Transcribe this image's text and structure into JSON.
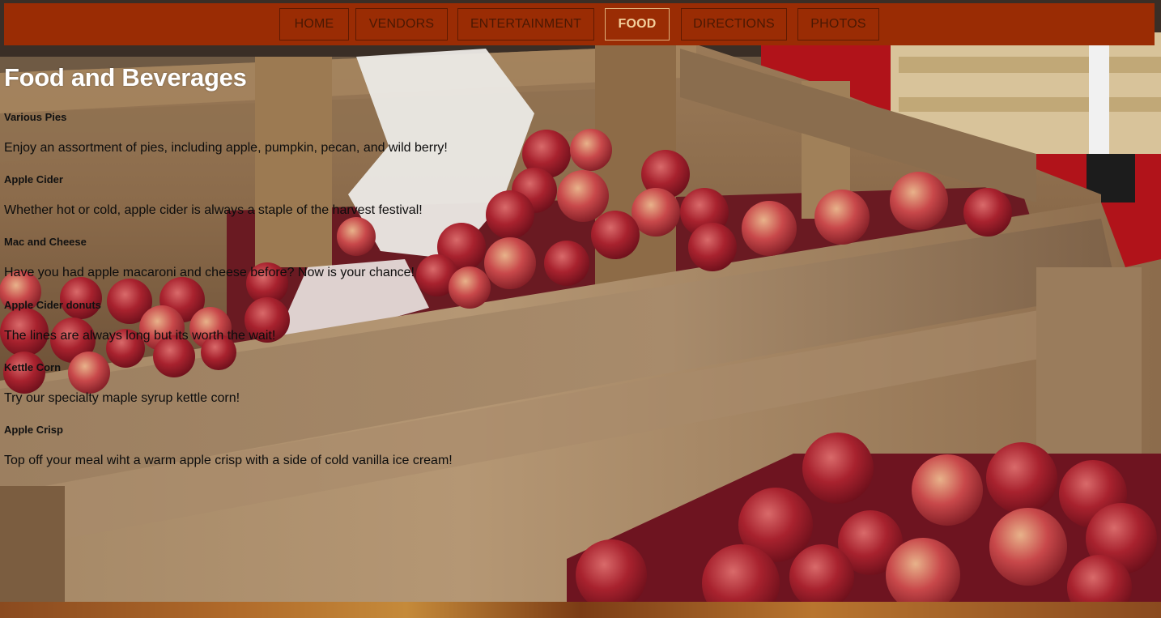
{
  "nav": {
    "items": [
      {
        "label": "HOME",
        "active": false
      },
      {
        "label": "VENDORS",
        "active": false
      },
      {
        "label": "ENTERTAINMENT",
        "active": false
      },
      {
        "label": "FOOD",
        "active": true
      },
      {
        "label": "DIRECTIONS",
        "active": false
      },
      {
        "label": "PHOTOS",
        "active": false
      }
    ]
  },
  "page": {
    "title": "Food and Beverages"
  },
  "menu": [
    {
      "name": "Various Pies",
      "description": "Enjoy an assortment of pies, including apple, pumpkin, pecan, and wild berry!"
    },
    {
      "name": "Apple Cider",
      "description": "Whether hot or cold, apple cider is always a staple of the harvest festival!"
    },
    {
      "name": "Mac and Cheese",
      "description": "Have you had apple macaroni and cheese before? Now is your chance!"
    },
    {
      "name": "Apple Cider donuts",
      "description": "The lines are always long but its worth the wait!"
    },
    {
      "name": "Kettle Corn",
      "description": "Try our specialty maple syrup kettle corn!"
    },
    {
      "name": "Apple Crisp",
      "description": "Top off your meal wiht a warm apple crisp with a side of cold vanilla ice cream!"
    }
  ],
  "colors": {
    "nav_background": "#9a2c04",
    "nav_active_text": "#f3cf9c",
    "nav_text": "#4a1803",
    "title_text": "#ffffff"
  }
}
